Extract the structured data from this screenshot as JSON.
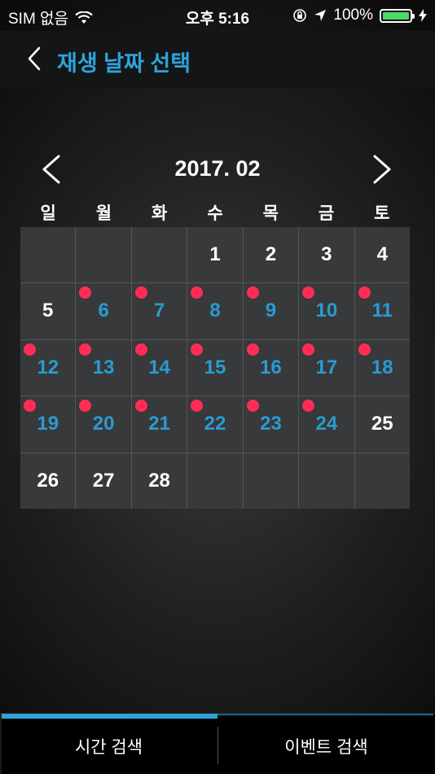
{
  "status_bar": {
    "carrier": "SIM 없음",
    "time": "오후 5:16",
    "battery": "100%",
    "battery_level": 1.0
  },
  "header": {
    "title": "재생 날짜 선택",
    "back_icon": "chevron-left-icon"
  },
  "calendar": {
    "month_label": "2017. 02",
    "prev_icon": "chevron-left-icon",
    "next_icon": "chevron-right-icon",
    "weekdays": [
      "일",
      "월",
      "화",
      "수",
      "목",
      "금",
      "토"
    ],
    "cells": [
      {
        "day": "",
        "event": false
      },
      {
        "day": "",
        "event": false
      },
      {
        "day": "",
        "event": false
      },
      {
        "day": "1",
        "event": false
      },
      {
        "day": "2",
        "event": false
      },
      {
        "day": "3",
        "event": false
      },
      {
        "day": "4",
        "event": false
      },
      {
        "day": "5",
        "event": false
      },
      {
        "day": "6",
        "event": true
      },
      {
        "day": "7",
        "event": true
      },
      {
        "day": "8",
        "event": true
      },
      {
        "day": "9",
        "event": true
      },
      {
        "day": "10",
        "event": true
      },
      {
        "day": "11",
        "event": true
      },
      {
        "day": "12",
        "event": true
      },
      {
        "day": "13",
        "event": true
      },
      {
        "day": "14",
        "event": true
      },
      {
        "day": "15",
        "event": true
      },
      {
        "day": "16",
        "event": true
      },
      {
        "day": "17",
        "event": true
      },
      {
        "day": "18",
        "event": true
      },
      {
        "day": "19",
        "event": true
      },
      {
        "day": "20",
        "event": true
      },
      {
        "day": "21",
        "event": true
      },
      {
        "day": "22",
        "event": true
      },
      {
        "day": "23",
        "event": true
      },
      {
        "day": "24",
        "event": true
      },
      {
        "day": "25",
        "event": false
      },
      {
        "day": "26",
        "event": false
      },
      {
        "day": "27",
        "event": false
      },
      {
        "day": "28",
        "event": false
      },
      {
        "day": "",
        "event": false
      },
      {
        "day": "",
        "event": false
      },
      {
        "day": "",
        "event": false
      },
      {
        "day": "",
        "event": false
      }
    ],
    "colors": {
      "event_day_text": "#2a9bd0",
      "event_dot": "#ff2d55",
      "normal_day_text": "#ffffff",
      "cell_bg": "#38393b"
    }
  },
  "tabs": [
    {
      "label": "시간 검색",
      "active": true
    },
    {
      "label": "이벤트 검색",
      "active": false
    }
  ],
  "accent_color": "#2ea3d8"
}
